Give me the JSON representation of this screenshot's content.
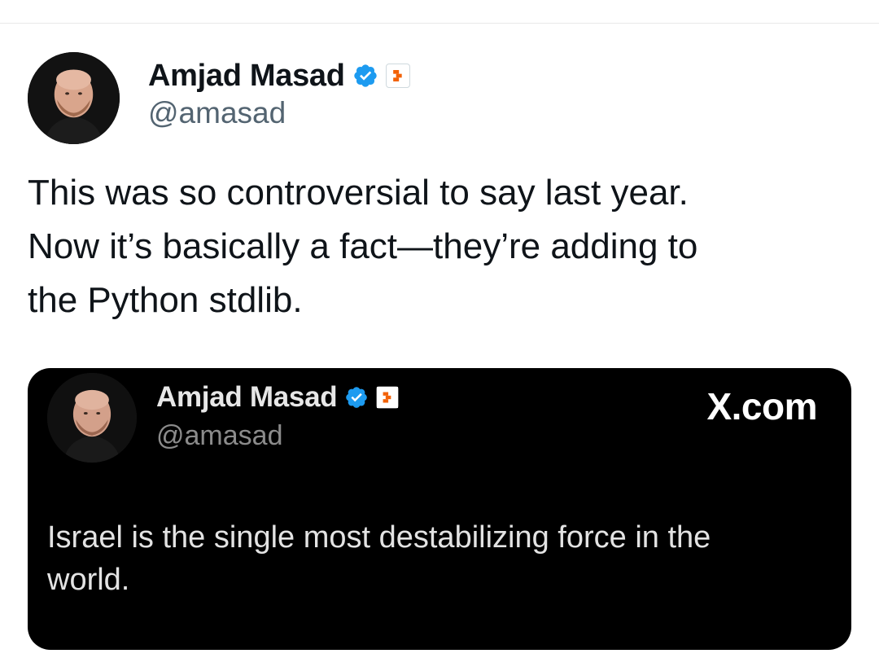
{
  "tweet": {
    "author": {
      "name": "Amjad Masad",
      "handle": "@amasad",
      "verified": true,
      "verified_color": "#1d9bf0",
      "affiliate_color": "#f26207"
    },
    "text_lines": [
      "This was so controversial to say last year.",
      "Now it’s basically a fact—they’re adding to",
      "the Python stdlib."
    ]
  },
  "quoted": {
    "author": {
      "name": "Amjad Masad",
      "handle": "@amasad"
    },
    "site_label": "X.com",
    "text_lines": [
      "Israel is the single most destabilizing force in the",
      "world."
    ]
  },
  "icons": {
    "verified": "verified-badge-icon",
    "affiliate": "replit-affiliate-icon",
    "avatar": "profile-photo"
  }
}
